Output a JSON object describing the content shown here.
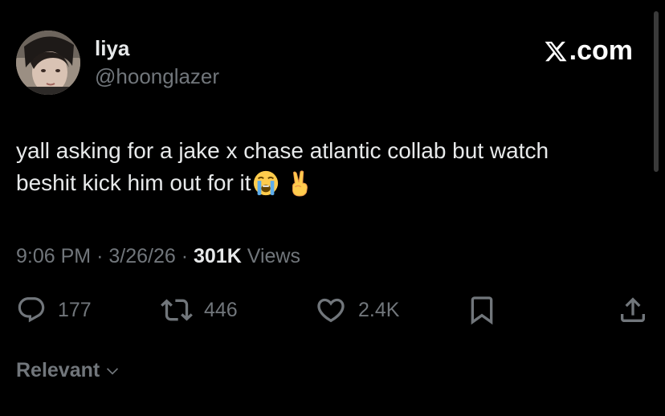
{
  "author": {
    "display_name": "liya",
    "handle": "@hoonglazer"
  },
  "brand": {
    "label": ".com",
    "logo_icon": "x-logo-icon"
  },
  "tweet": {
    "text_line_1": "yall asking for a jake x chase atlantic collab but watch",
    "text_line_2": "beshit kick him out for it",
    "emojis": [
      "loudly-crying-face-icon",
      "victory-hand-icon"
    ]
  },
  "meta": {
    "time": "9:06 PM",
    "separator": "·",
    "date": "3/26/26",
    "views_count": "301K",
    "views_label": "Views"
  },
  "actions": {
    "replies": "177",
    "reposts": "446",
    "likes": "2.4K"
  },
  "sort": {
    "label": "Relevant"
  },
  "colors": {
    "background": "#000000",
    "primary_text": "#e7e9ea",
    "secondary_text": "#71767b"
  }
}
